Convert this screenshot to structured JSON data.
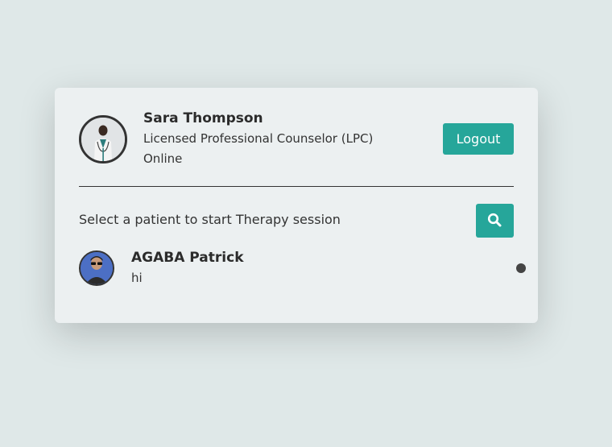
{
  "therapist": {
    "name": "Sara Thompson",
    "title": "Licensed Professional Counselor (LPC)",
    "status": "Online",
    "avatar_icon": "therapist-avatar"
  },
  "header": {
    "logout_label": "Logout"
  },
  "search": {
    "prompt": "Select a patient to start Therapy session",
    "icon": "search-icon"
  },
  "patients": [
    {
      "name": "AGABA Patrick",
      "last_message": "hi",
      "avatar_icon": "patient-avatar",
      "status_color": "#444444"
    }
  ],
  "colors": {
    "accent": "#26a69a",
    "background": "#dfe8e8",
    "card": "#ecf0f1"
  }
}
